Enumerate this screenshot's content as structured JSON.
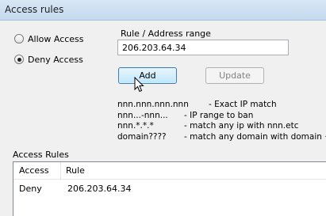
{
  "window": {
    "title": "Access rules"
  },
  "mode": {
    "options": [
      {
        "label": "Allow Access",
        "checked": false
      },
      {
        "label": "Deny Access",
        "checked": true
      }
    ]
  },
  "rule_input": {
    "label": "Rule / Address range",
    "value": "206.203.64.34"
  },
  "buttons": {
    "add": "Add",
    "update": "Update"
  },
  "help": [
    {
      "pattern": "nnn.nnn.nnn.nnn",
      "description": "- Exact IP match"
    },
    {
      "pattern": "nnn...-nnn...",
      "description": "- IP range to ban"
    },
    {
      "pattern": "nnn.*.*.*",
      "description": "- match any ip with nnn.etc"
    },
    {
      "pattern": "domain????",
      "description": "- match any domain with domain + ?"
    }
  ],
  "rules_table": {
    "label": "Access Rules",
    "columns": [
      "Access",
      "Rule"
    ],
    "rows": [
      {
        "access": "Deny",
        "rule": "206.203.64.34"
      }
    ]
  }
}
